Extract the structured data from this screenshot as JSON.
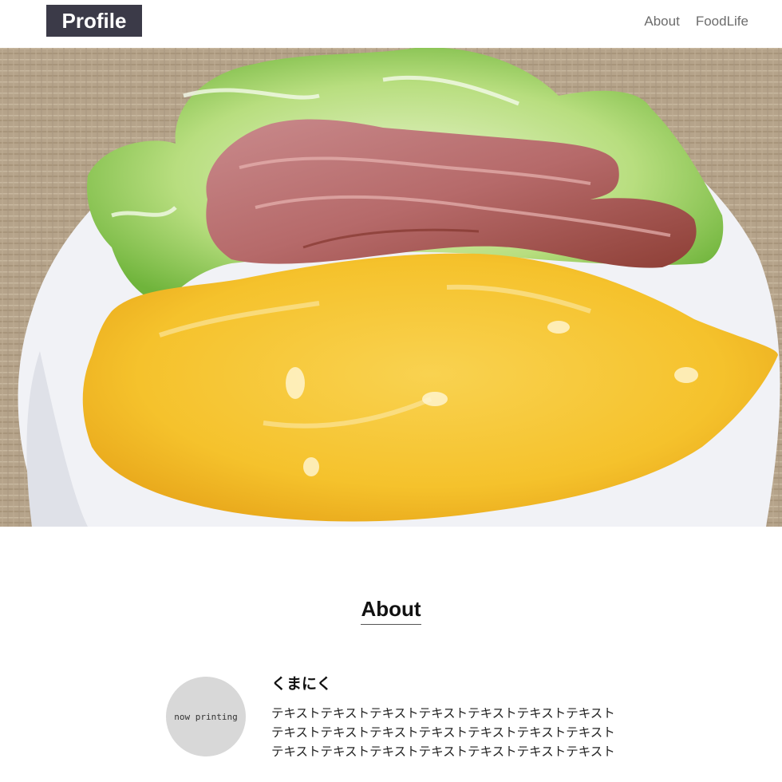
{
  "header": {
    "logo": "Profile",
    "nav": [
      {
        "label": "About"
      },
      {
        "label": "FoodLife"
      }
    ]
  },
  "hero": {
    "icon": "omelette-bacon-lettuce-photo"
  },
  "about": {
    "title": "About",
    "avatar_text": "now printing",
    "name": "くまにく",
    "lines": [
      "テキストテキストテキストテキストテキストテキストテキスト",
      "テキストテキストテキストテキストテキストテキストテキスト",
      "テキストテキストテキストテキストテキストテキストテキスト"
    ]
  },
  "colors": {
    "logo_bg": "#3b3a48",
    "nav_text": "#6c6c6c",
    "avatar_bg": "#d8d8d8",
    "omelette": "#f7c531",
    "tablecloth": "#b7a58c"
  }
}
